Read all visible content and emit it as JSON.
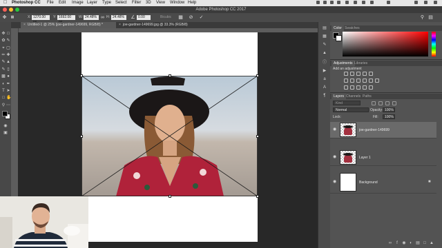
{
  "menubar": {
    "app_name": "Photoshop CC",
    "items": [
      "File",
      "Edit",
      "Image",
      "Layer",
      "Type",
      "Select",
      "Filter",
      "3D",
      "View",
      "Window",
      "Help"
    ]
  },
  "titlebar": {
    "title": "Adobe Photoshop CC 2017"
  },
  "options": {
    "x_label": "X:",
    "x_value": "1270.00 px",
    "y_label": "Y:",
    "y_value": "1692.00 px",
    "w_label": "W:",
    "w_value": "24.48%",
    "h_label": "H:",
    "h_value": "24.48%",
    "angle_value": "0.00",
    "interp_label": "Bicubic",
    "h_skew_value": "0.00"
  },
  "tabs": [
    {
      "label": "Untitled-1 @ 25% (joe-gardner-149699, RGB/8) *",
      "active": true
    },
    {
      "label": "joe-gardner-149699.jpg @ 33.3% (RGB/8)",
      "active": false
    }
  ],
  "panels": {
    "color_tab": "Color",
    "swatches_tab": "Swatches",
    "adjustments_tab": "Adjustments",
    "libraries_tab": "Libraries",
    "add_adjustment": "Add an adjustment",
    "layers_tab": "Layers",
    "channels_tab": "Channels",
    "paths_tab": "Paths",
    "kind_filter": "Kind",
    "blend_mode": "Normal",
    "opacity_label": "Opacity:",
    "opacity_value": "100%",
    "lock_label": "Lock:",
    "fill_label": "Fill:",
    "fill_value": "100%"
  },
  "layers": [
    {
      "name": "joe-gardner-149699",
      "selected": true
    },
    {
      "name": "Layer 1",
      "selected": false
    },
    {
      "name": "Background",
      "selected": false
    }
  ],
  "colors": {
    "ui_dark": "#535353",
    "accent_selected_layer": "#6a6a6a",
    "foreground_color": "#000000",
    "background_color": "#ffffff",
    "color_field_hue": "#ff0000"
  }
}
